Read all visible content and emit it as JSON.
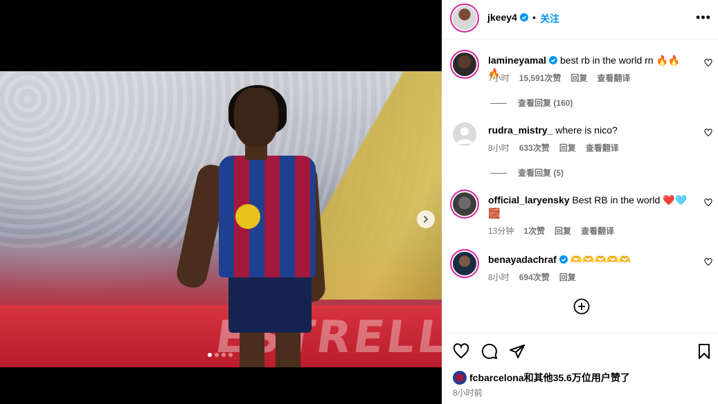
{
  "post": {
    "author": "jkeey4",
    "separator": "•",
    "follow_label": "关注",
    "more_label": "•••",
    "dots_count": 4,
    "active_dot": 0,
    "photo_banner_text": "ESTRELL"
  },
  "comments": [
    {
      "user": "lamineyamal",
      "verified": true,
      "text": "best rb in the world rn 🔥🔥🔥",
      "age": "7小时",
      "likes": "15,591次赞",
      "reply": "回复",
      "translate": "查看翻译",
      "view_replies": "查看回复 (160)"
    },
    {
      "user": "rudra_mistry_",
      "verified": false,
      "text": "where is nico?",
      "age": "8小时",
      "likes": "633次赞",
      "reply": "回复",
      "translate": "查看翻译",
      "view_replies": "查看回复 (5)"
    },
    {
      "user": "official_laryensky",
      "verified": false,
      "text": "Best RB in the world ❤️🩵",
      "text_line2": "🧱",
      "age": "13分钟",
      "likes": "1次赞",
      "reply": "回复",
      "translate": "查看翻译"
    },
    {
      "user": "benayadachraf",
      "verified": true,
      "text": "🫶🫶🫶🫶🫶",
      "age": "8小时",
      "likes": "694次赞",
      "reply": "回复"
    }
  ],
  "footer": {
    "likes_text": "fcbarcelona和其他35.6万位用户赞了",
    "time_text": "8小时前"
  },
  "colors": {
    "accent": "#0095f6",
    "muted": "#737373",
    "ring": "#d6249f"
  },
  "icons": [
    "verified-icon",
    "heart-icon",
    "comment-icon",
    "share-icon",
    "bookmark-icon",
    "add-circle-icon",
    "chevron-right-icon",
    "more-icon"
  ]
}
